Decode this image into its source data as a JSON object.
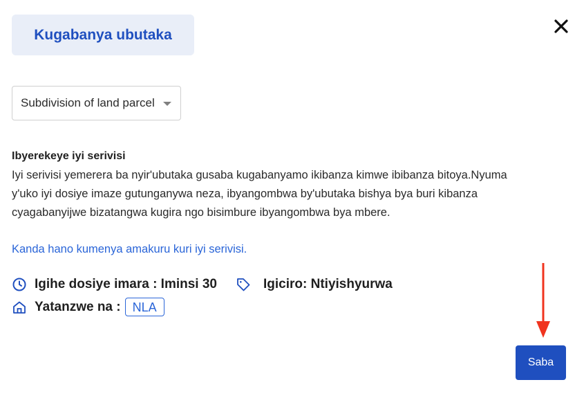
{
  "service_tab": {
    "label": "Kugabanya ubutaka"
  },
  "service_select": {
    "selected": "Subdivision of land parcel"
  },
  "about": {
    "heading": "Ibyerekeye iyi serivisi",
    "lines": [
      "Iyi serivisi yemerera ba nyir'ubutaka gusaba kugabanyamo ikibanza kimwe ibibanza bitoya.Nyuma",
      "y'uko iyi dosiye imaze gutunganywa neza, ibyangombwa by'ubutaka bishya bya buri kibanza",
      "cyagabanyijwe bizatangwa kugira ngo bisimbure ibyangombwa bya mbere."
    ]
  },
  "info_link": {
    "label": "Kanda hano kumenya amakuru kuri iyi serivisi."
  },
  "meta": {
    "duration": "Igihe dosiye imara : Iminsi 30",
    "price": "Igiciro: Ntiyishyurwa",
    "provider_label": "Yatanzwe na :",
    "provider_badge": "NLA"
  },
  "actions": {
    "primary_label": "Saba"
  },
  "colors": {
    "brand_blue": "#1f4fbf",
    "link_blue": "#2a65d8",
    "tab_bg": "#e9eef8",
    "annotation_arrow": "#f0341f"
  },
  "icons": [
    "close-icon",
    "dropdown-caret-icon",
    "clock-icon",
    "tag-icon",
    "home-icon",
    "arrow-down-annotation"
  ]
}
